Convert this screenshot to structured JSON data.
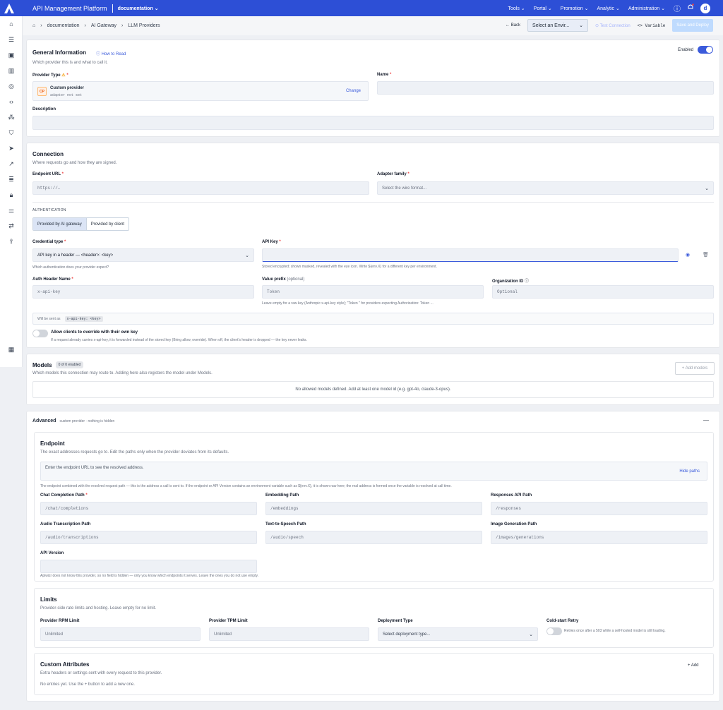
{
  "header": {
    "app_title": "API Management Platform",
    "org": "documentation",
    "nav": [
      "Tools",
      "Portal",
      "Promotion",
      "Analytic",
      "Administration"
    ],
    "avatar": "d"
  },
  "breadcrumb": [
    "documentation",
    "AI Gateway",
    "LLM Providers"
  ],
  "actions": {
    "back": "Back",
    "env_placeholder": "Select an Envir...",
    "test": "Test Connection",
    "variable": "Variable",
    "save": "Save and Deploy"
  },
  "general": {
    "title": "General Information",
    "how_to": "How to Read",
    "subtitle": "Which provider this is and what to call it.",
    "enabled": "Enabled",
    "provider_type_label": "Provider Type",
    "provider_badge": "CP",
    "provider_name": "Custom provider",
    "provider_adapter": "adapter not set",
    "change": "Change",
    "name_label": "Name",
    "desc_label": "Description"
  },
  "connection": {
    "title": "Connection",
    "subtitle": "Where requests go and how they are signed.",
    "endpoint_label": "Endpoint URL",
    "endpoint_value": "https://…",
    "adapter_label": "Adapter family",
    "adapter_placeholder": "Select the wire format...",
    "auth_heading": "AUTHENTICATION",
    "auth_seg": [
      "Provided by AI gateway",
      "Provided by client"
    ],
    "cred_label": "Credential type",
    "cred_value": "API key in a header — <header>: <key>",
    "cred_help": "Which authentication does your provider expect?",
    "apikey_label": "API Key",
    "apikey_help": "Stored encrypted; shown masked, revealed with the eye icon. Write ${env.X} for a different key per environment.",
    "header_name_label": "Auth Header Name",
    "header_name_value": "x-api-key",
    "prefix_label": "Value prefix",
    "prefix_opt": "(optional)",
    "prefix_value": "Token",
    "prefix_help": "Leave empty for a raw key (Anthropic x-api-key style); \"Token \" for providers expecting Authorization: Token ...",
    "org_label": "Organization ID",
    "org_value": "Optional",
    "sent_as": "Will be sent as",
    "sent_code": "x-api-key: <key>",
    "override_label": "Allow clients to override with their own key",
    "override_help": "If a request already carries x-api-key, it is forwarded instead of the stored key (Bring allow, override). When off, the client's header is dropped — the key never leaks."
  },
  "models": {
    "title": "Models",
    "badge": "0 of 0 enabled",
    "subtitle": "Which models this connection may route to. Adding here also registers the model under Models.",
    "add": "+ Add models",
    "empty": "No allowed models defined. Add at least one model id (e.g. gpt-4o, claude-3-opus)."
  },
  "advanced": {
    "title": "Advanced",
    "note": "custom provider · nothing is hidden",
    "collapse": "—"
  },
  "endpoint": {
    "title": "Endpoint",
    "subtitle": "The exact addresses requests go to. Edit the paths only when the provider deviates from its defaults.",
    "resolved": "Enter the endpoint URL to see the resolved address.",
    "hide": "Hide paths",
    "help": "The endpoint combined with the resolved request path — this is the address a call is sent to. If the endpoint or API Version contains an environment variable such as ${env.X}, it is shown raw here; the real address is formed once the variable is resolved at call time.",
    "fields": [
      {
        "label": "Chat Completion Path",
        "value": "/chat/completions",
        "req": "*"
      },
      {
        "label": "Embedding Path",
        "value": "/embeddings",
        "req": ""
      },
      {
        "label": "Responses API Path",
        "value": "/responses",
        "req": ""
      },
      {
        "label": "Audio Transcription Path",
        "value": "/audio/transcriptions",
        "req": ""
      },
      {
        "label": "Text-to-Speech Path",
        "value": "/audio/speech",
        "req": ""
      },
      {
        "label": "Image Generation Path",
        "value": "/images/generations",
        "req": ""
      }
    ],
    "api_version_label": "API Version",
    "footer": "Apiwizr does not know this provider, so no field is hidden — only you know which endpoints it serves. Leave the ones you do not use empty."
  },
  "limits": {
    "title": "Limits",
    "subtitle": "Provider-side rate limits and hosting. Leave empty for no limit.",
    "rpm_label": "Provider RPM Limit",
    "rpm_value": "Unlimited",
    "tpm_label": "Provider TPM Limit",
    "tpm_value": "Unlimited",
    "deploy_label": "Deployment Type",
    "deploy_value": "Select deployment type...",
    "retry_label": "Cold-start Retry",
    "retry_help": "Retries once after a 503 while a self-hosted model is still loading."
  },
  "custom": {
    "title": "Custom Attributes",
    "subtitle": "Extra headers or settings sent with every request to this provider.",
    "add": "+ Add",
    "empty": "No entries yet. Use the + button to add a new one."
  }
}
